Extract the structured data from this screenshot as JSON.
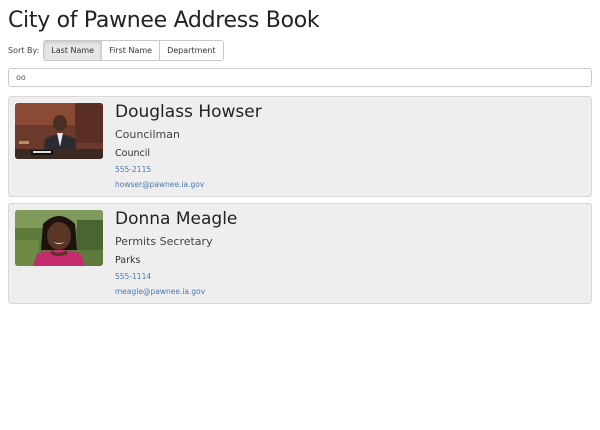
{
  "page": {
    "title": "City of Pawnee Address Book"
  },
  "sort": {
    "label": "Sort By:",
    "options": [
      "Last Name",
      "First Name",
      "Department"
    ],
    "selected": "Last Name"
  },
  "search": {
    "value": "oo",
    "placeholder": ""
  },
  "contacts": [
    {
      "name": "Douglass Howser",
      "title": "Councilman",
      "department": "Council",
      "phone": "555-2115",
      "email": "howser@pawnee.ia.gov",
      "photo_icon": "person-photo"
    },
    {
      "name": "Donna Meagle",
      "title": "Permits Secretary",
      "department": "Parks",
      "phone": "555-1114",
      "email": "meagle@pawnee.ia.gov",
      "photo_icon": "person-photo"
    }
  ],
  "colors": {
    "card_bg": "#eeeeee",
    "link": "#4a7ab3",
    "active_button": "#e6e6e6"
  }
}
